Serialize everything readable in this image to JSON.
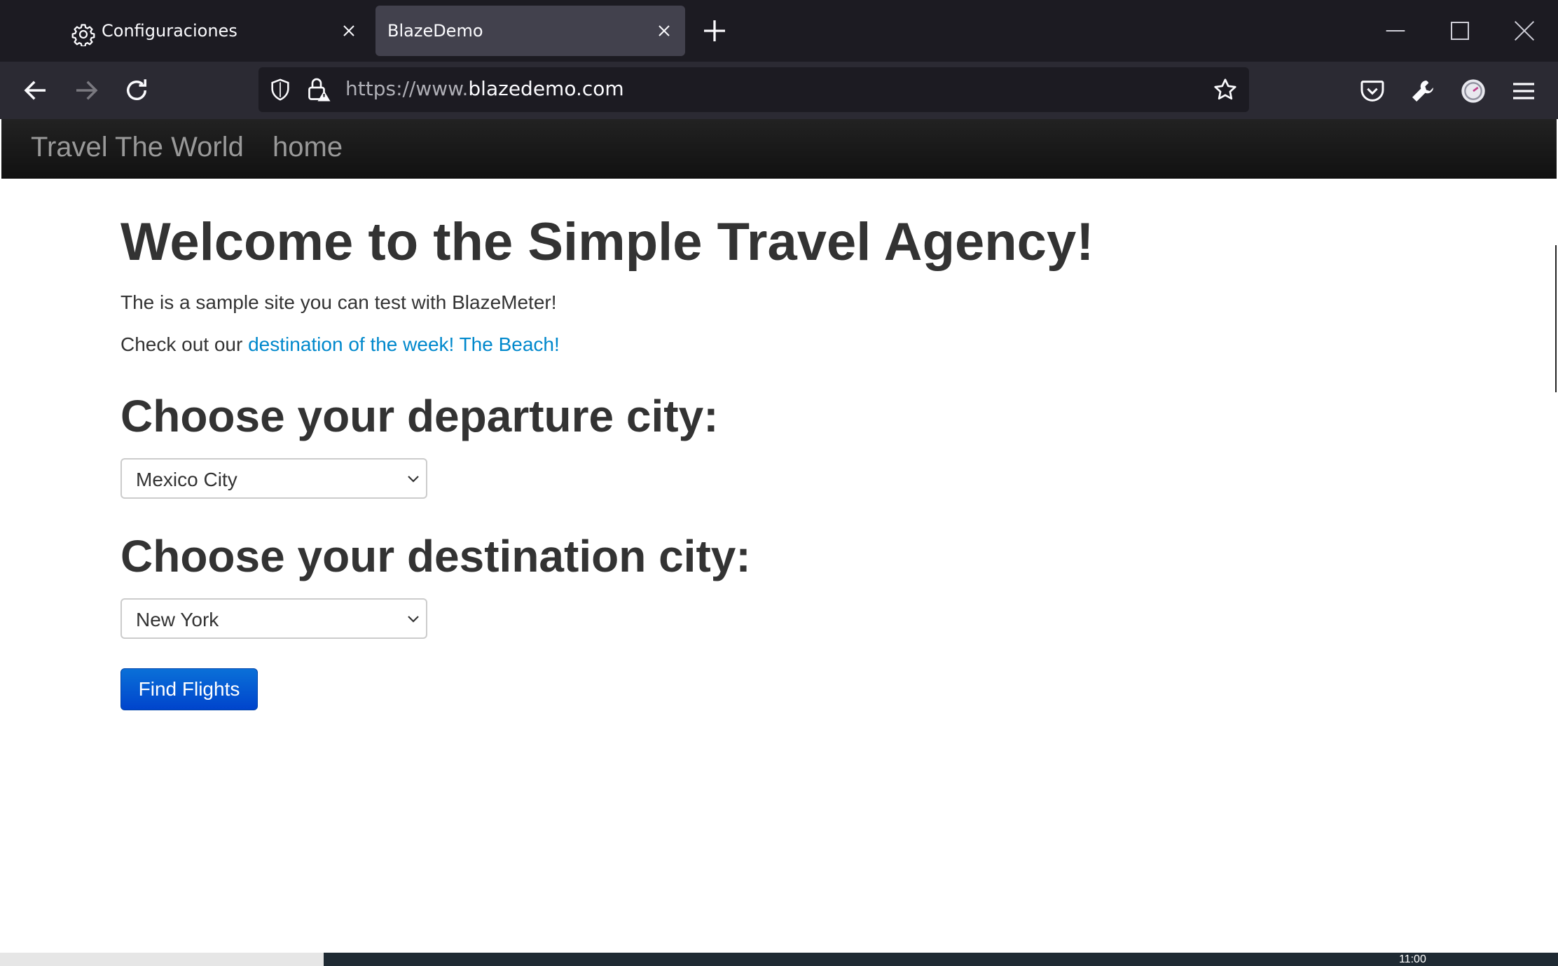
{
  "browser": {
    "tabs": [
      {
        "label": "Configuraciones",
        "icon": "gear-icon",
        "active": false
      },
      {
        "label": "BlazeDemo",
        "active": true
      }
    ],
    "url": {
      "prefix": "https://www.",
      "host": "blazedemo.com"
    }
  },
  "site": {
    "brand": "Travel The World",
    "nav_home": "home"
  },
  "main": {
    "title": "Welcome to the Simple Travel Agency!",
    "lead": "The is a sample site you can test with BlazeMeter!",
    "promo_prefix": "Check out our",
    "promo_link": "destination of the week! The Beach!",
    "departure_heading": "Choose your departure city:",
    "departure_value": "Mexico City",
    "destination_heading": "Choose your destination city:",
    "destination_value": "New York",
    "find_button": "Find Flights"
  },
  "taskbar": {
    "clock": "11:00"
  },
  "colors": {
    "tabstrip": "#1c1b22",
    "navbar": "#2b2a33",
    "link": "#0088cc",
    "button": "#0055cc"
  }
}
